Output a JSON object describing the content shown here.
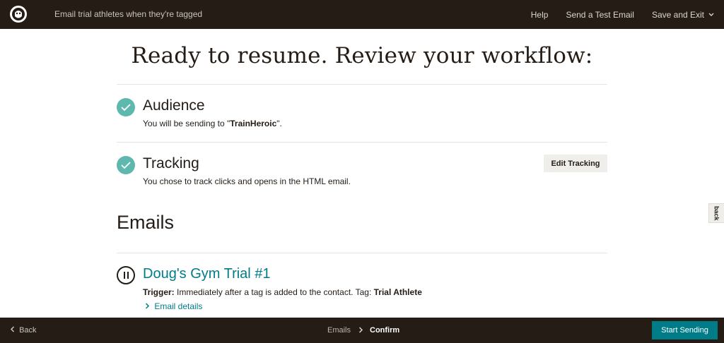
{
  "header": {
    "campaign_title": "Email trial athletes when they're tagged",
    "help_label": "Help",
    "test_email_label": "Send a Test Email",
    "save_exit_label": "Save and Exit"
  },
  "main": {
    "title": "Ready to resume. Review your workflow:",
    "audience": {
      "heading": "Audience",
      "text_prefix": "You will be sending to \"",
      "audience_name": "TrainHeroic",
      "text_suffix": "\"."
    },
    "tracking": {
      "heading": "Tracking",
      "text": "You chose to track clicks and opens in the HTML email.",
      "edit_label": "Edit Tracking"
    },
    "emails_heading": "Emails",
    "emails": [
      {
        "name": "Doug's Gym Trial #1",
        "trigger_label": "Trigger:",
        "trigger_text": " Immediately after a tag is added to the contact. Tag: ",
        "tag_name": "Trial Athlete",
        "details_label": "Email details"
      }
    ]
  },
  "side_tab_label": "back",
  "footer": {
    "back_label": "Back",
    "step_emails": "Emails",
    "step_confirm": "Confirm",
    "start_label": "Start Sending"
  },
  "colors": {
    "top_bar": "#241c15",
    "check": "#5fb8ae",
    "link": "#007c89",
    "button_primary": "#007c89"
  }
}
